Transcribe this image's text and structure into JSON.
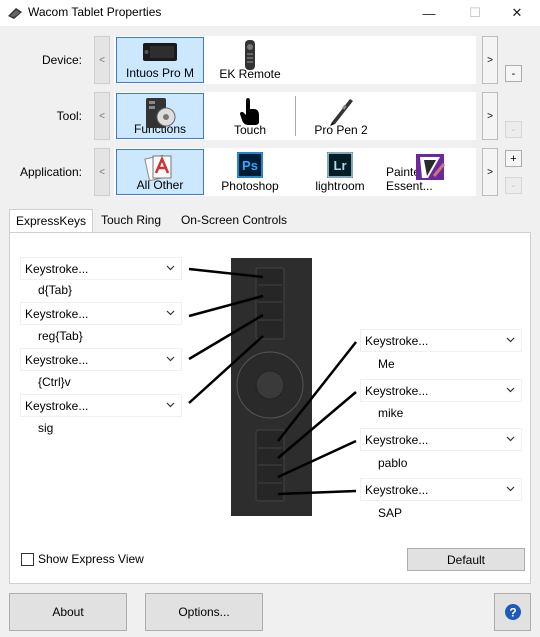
{
  "window": {
    "title": "Wacom Tablet Properties",
    "minimize_glyph": "—",
    "maximize_glyph": "☐",
    "close_glyph": "✕"
  },
  "rows": {
    "device": {
      "label": "Device:",
      "items": [
        {
          "label": "Intuos Pro M",
          "icon": "tablet-icon",
          "selected": true
        },
        {
          "label": "EK Remote",
          "icon": "remote-icon",
          "selected": false
        }
      ],
      "side_button": "-"
    },
    "tool": {
      "label": "Tool:",
      "items": [
        {
          "label": "Functions",
          "icon": "functions-icon",
          "selected": true
        },
        {
          "label": "Touch",
          "icon": "touch-hand-icon",
          "selected": false
        },
        {
          "label": "Pro Pen 2",
          "icon": "pen-icon",
          "selected": false
        }
      ],
      "side_button": "-"
    },
    "application": {
      "label": "Application:",
      "items": [
        {
          "label": "All Other",
          "icon": "all-other-apps-icon",
          "selected": true
        },
        {
          "label": "Photoshop",
          "icon": "photoshop-icon",
          "selected": false
        },
        {
          "label": "lightroom",
          "icon": "lightroom-icon",
          "selected": false
        },
        {
          "label": "Painter Essent...",
          "icon": "painter-icon",
          "selected": false
        }
      ],
      "side_button_add": "+",
      "side_button_remove": "-"
    },
    "scroll_left": "<",
    "scroll_right": ">"
  },
  "icons": {
    "ps_text": "Ps",
    "lr_text": "Lr"
  },
  "tabs": [
    "ExpressKeys",
    "Touch Ring",
    "On-Screen Controls"
  ],
  "expresskeys": {
    "left": [
      {
        "setting": "Keystroke...",
        "value": "d{Tab}"
      },
      {
        "setting": "Keystroke...",
        "value": "reg{Tab}"
      },
      {
        "setting": "Keystroke...",
        "value": "{Ctrl}v"
      },
      {
        "setting": "Keystroke...",
        "value": "sig"
      }
    ],
    "right": [
      {
        "setting": "Keystroke...",
        "value": "Me"
      },
      {
        "setting": "Keystroke...",
        "value": "mike"
      },
      {
        "setting": "Keystroke...",
        "value": "pablo"
      },
      {
        "setting": "Keystroke...",
        "value": "SAP"
      }
    ]
  },
  "show_express_view": {
    "label": "Show Express View",
    "checked": false
  },
  "buttons": {
    "default": "Default",
    "about": "About",
    "options": "Options...",
    "help": "?"
  },
  "colors": {
    "selection": "#cce8ff",
    "selection_border": "#3f79c7",
    "tablet": "#2d2d2d",
    "help_blue": "#1e5bb8"
  }
}
